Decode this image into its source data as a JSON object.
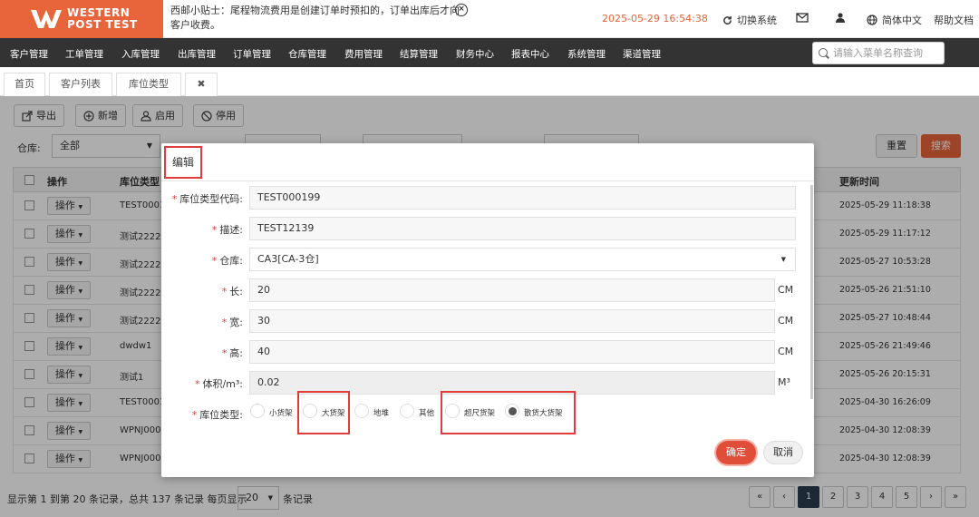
{
  "header": {
    "logo_line1": "WESTERN",
    "logo_line2": "POST TEST",
    "tip_text": "西邮小贴士：尾程物流费用是创建订单时预扣的，订单出库后才向客户收费。",
    "datetime": "2025-05-29 16:54:38",
    "switch_system": "切换系统",
    "language": "简体中文",
    "help": "帮助文档"
  },
  "nav": {
    "items": [
      "客户管理",
      "工单管理",
      "入库管理",
      "出库管理",
      "订单管理",
      "仓库管理",
      "费用管理",
      "结算管理",
      "财务中心",
      "报表中心",
      "系统管理",
      "渠道管理"
    ],
    "search_placeholder": "请输入菜单名称查询"
  },
  "tabs": [
    {
      "label": "首页"
    },
    {
      "label": "客户列表"
    },
    {
      "label": "库位类型"
    }
  ],
  "toolbar": {
    "export": "导出",
    "add": "新增",
    "enable": "启用",
    "disable": "停用"
  },
  "filters": {
    "warehouse_label": "仓库:",
    "warehouse_value": "全部",
    "reset": "重置",
    "search": "搜索"
  },
  "table": {
    "headers": [
      "操作",
      "库位类型",
      "更新时间"
    ],
    "op_label": "操作",
    "rows": [
      {
        "code": "TEST00019",
        "time": "2025-05-29 11:18:38"
      },
      {
        "code": "测试22221",
        "time": "2025-05-29 11:17:12"
      },
      {
        "code": "测试22229",
        "time": "2025-05-27 10:53:28"
      },
      {
        "code": "测试22229",
        "time": "2025-05-26 21:51:10"
      },
      {
        "code": "测试22221",
        "time": "2025-05-27 10:48:44"
      },
      {
        "code": "dwdw1",
        "time": "2025-05-26 21:49:46"
      },
      {
        "code": "测试1",
        "time": "2025-05-26 20:15:31"
      },
      {
        "code": "TEST0001",
        "time": "2025-04-30 16:26:09"
      },
      {
        "code": "WPNJ0003",
        "time": "2025-04-30 12:08:39"
      },
      {
        "code": "WPNJ0002",
        "time": "2025-04-30 12:08:39"
      }
    ]
  },
  "footer": {
    "summary": "显示第 1 到第 20 条记录，总共 137 条记录 每页显示",
    "page_size": "20",
    "suffix": "条记录",
    "pages": [
      "«",
      "‹",
      "1",
      "2",
      "3",
      "4",
      "5",
      "›",
      "»"
    ]
  },
  "modal": {
    "title": "编辑",
    "fields": [
      {
        "label": "库位类型代码:",
        "value": "TEST000199"
      },
      {
        "label": "描述:",
        "value": "TEST12139"
      },
      {
        "label": "仓库:",
        "value": "CA3[CA-3仓]"
      },
      {
        "label": "长:",
        "value": "20",
        "unit": "CM"
      },
      {
        "label": "宽:",
        "value": "30",
        "unit": "CM"
      },
      {
        "label": "高:",
        "value": "40",
        "unit": "CM"
      },
      {
        "label": "体积/m³:",
        "value": "0.02",
        "unit": "M³"
      }
    ],
    "type_label": "库位类型:",
    "type_options": [
      "小货架",
      "大货架",
      "地堆",
      "其他",
      "超尺货架",
      "散货大货架"
    ],
    "selected_type": "散货大货架",
    "ok": "确定",
    "cancel": "取消"
  },
  "colors": {
    "brand": "#e8643a",
    "nav_bg": "#333333",
    "highlight": "#e03c3c"
  }
}
